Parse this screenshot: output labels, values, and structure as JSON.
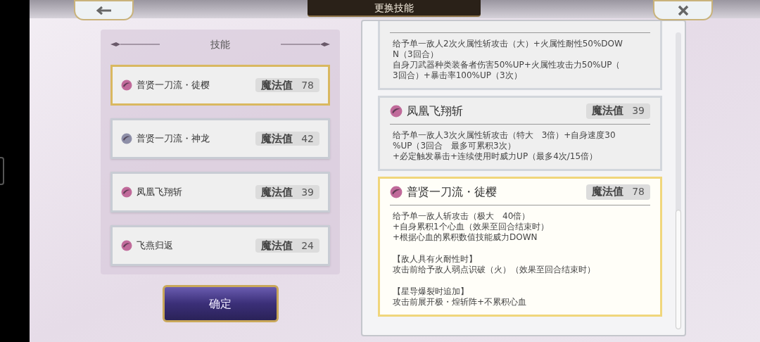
{
  "header": {
    "title": "更换技能"
  },
  "skill_list": {
    "heading": "技能",
    "items": [
      {
        "name": "普贤一刀流・徒樱",
        "cost_label": "魔法值",
        "cost": "78",
        "selected": true,
        "color": "#c06a9a"
      },
      {
        "name": "普贤一刀流・神龙",
        "cost_label": "魔法值",
        "cost": "42",
        "selected": false,
        "color": "#8e8fa8"
      },
      {
        "name": "凤凰飞翔斩",
        "cost_label": "魔法值",
        "cost": "39",
        "selected": false,
        "color": "#c06a9a"
      },
      {
        "name": "飞燕归返",
        "cost_label": "魔法值",
        "cost": "24",
        "selected": false,
        "color": "#c06a9a"
      }
    ]
  },
  "confirm_button": "确定",
  "details": [
    {
      "selected": false,
      "paragraphs": [
        [
          "给予单一敌人2次火属性斩攻击（大）+火属性耐性50%DOW",
          "N（3回合）",
          "自身刀武器种类装备者伤害50%UP+火属性攻击力50%UP（",
          "3回合）+暴击率100%UP（3次）"
        ]
      ]
    },
    {
      "name": "凤凰飞翔斩",
      "cost_label": "魔法值",
      "cost": "39",
      "color": "#c06a9a",
      "selected": false,
      "paragraphs": [
        [
          "给予单一敌人3次火属性斩攻击（特大　3倍）+自身速度30",
          "%UP（3回合　最多可累积3次）",
          "+必定触发暴击+连续使用时威力UP（最多4次/15倍）"
        ]
      ]
    },
    {
      "name": "普贤一刀流・徒樱",
      "cost_label": "魔法值",
      "cost": "78",
      "color": "#c06a9a",
      "selected": true,
      "paragraphs": [
        [
          "给予单一敌人斩攻击（极大　40倍）",
          "+自身累积1个心血（效果至回合结束时）",
          "+根据心血的累积数值技能威力DOWN"
        ],
        [
          "【敌人具有火耐性时】",
          "攻击前给予敌人弱点识破（火）（效果至回合结束时）"
        ],
        [
          "【星导爆裂时追加】",
          "攻击前展开极・煌斩阵+不累积心血"
        ]
      ]
    }
  ]
}
